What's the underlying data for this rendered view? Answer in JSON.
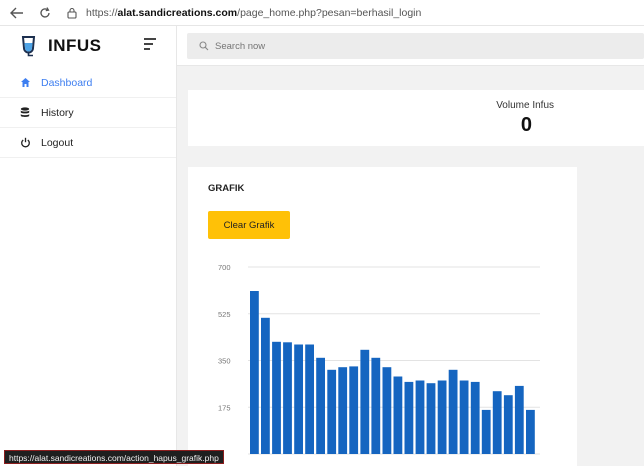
{
  "browser": {
    "url_prefix": "https://",
    "url_domain": "alat.sandicreations.com",
    "url_path": "/page_home.php?pesan=berhasil_login"
  },
  "brand": {
    "name": "INFUS"
  },
  "sidebar": {
    "items": [
      {
        "label": "Dashboard",
        "icon": "home-icon",
        "active": true
      },
      {
        "label": "History",
        "icon": "database-icon",
        "active": false
      },
      {
        "label": "Logout",
        "icon": "power-icon",
        "active": false
      }
    ]
  },
  "search": {
    "placeholder": "Search now"
  },
  "volume": {
    "label": "Volume Infus",
    "value": "0"
  },
  "grafik": {
    "title": "GRAFIK",
    "clear_label": "Clear Grafik"
  },
  "chart_data": {
    "type": "bar",
    "ylim": [
      0,
      700
    ],
    "yticks": [
      "700",
      "525",
      "350",
      "175",
      "0"
    ],
    "grid": true,
    "color": "#1565c0",
    "values": [
      610,
      510,
      420,
      418,
      410,
      410,
      360,
      315,
      325,
      328,
      390,
      360,
      325,
      290,
      270,
      275,
      265,
      275,
      315,
      275,
      270,
      165,
      235,
      220,
      255,
      165
    ]
  },
  "status_bar": {
    "url": "https://alat.sandicreations.com/action_hapus_grafik.php"
  },
  "colors": {
    "accent": "#3d7ef0",
    "button": "#ffc107",
    "bar": "#1565c0"
  }
}
